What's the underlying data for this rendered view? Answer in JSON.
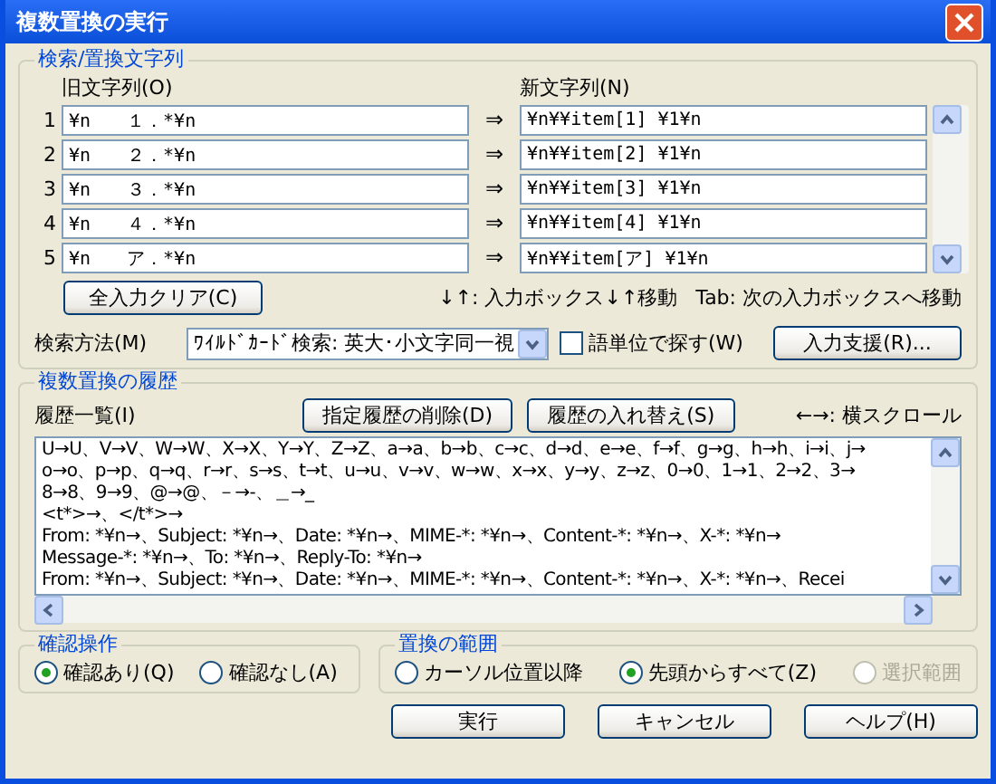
{
  "window": {
    "title": "複数置換の実行"
  },
  "search_group": {
    "title": "検索/置換文字列",
    "old_label": "旧文字列(O)",
    "new_label": "新文字列(N)",
    "rows": [
      {
        "number": "1",
        "old": "¥n　　１．*¥n",
        "arrow": "⇒",
        "new": "¥n¥¥item[1] ¥1¥n"
      },
      {
        "number": "2",
        "old": "¥n　　２．*¥n",
        "arrow": "⇒",
        "new": "¥n¥¥item[2] ¥1¥n"
      },
      {
        "number": "3",
        "old": "¥n　　３．*¥n",
        "arrow": "⇒",
        "new": "¥n¥¥item[3] ¥1¥n"
      },
      {
        "number": "4",
        "old": "¥n　　４．*¥n",
        "arrow": "⇒",
        "new": "¥n¥¥item[4] ¥1¥n"
      },
      {
        "number": "5",
        "old": "¥n　　ア．*¥n",
        "arrow": "⇒",
        "new": "¥n¥¥item[ア] ¥1¥n"
      }
    ],
    "clear_button": "全入力クリア(C)",
    "hint_arrows": "↓↑: 入力ボックス↓↑移動",
    "hint_tab": "Tab: 次の入力ボックスへ移動",
    "method_label": "検索方法(M)",
    "method_value": "ﾜｲﾙﾄﾞｶｰﾄﾞ検索: 英大･小文字同一視",
    "word_unit": {
      "label": "語単位で探す(W)",
      "checked": false
    },
    "assist_button": "入力支援(R)..."
  },
  "history_group": {
    "title": "複数置換の履歴",
    "list_label": "履歴一覧(I)",
    "delete_button": "指定履歴の削除(D)",
    "swap_button": "履歴の入れ替え(S)",
    "scroll_hint": "←→: 横スクロール",
    "lines": [
      "U→U、V→V、W→W、X→X、Y→Y、Z→Z、a→a、b→b、c→c、d→d、e→e、f→f、g→g、h→h、i→i、j→",
      "o→o、p→p、q→q、r→r、s→s、t→t、u→u、v→v、w→w、x→x、y→y、z→z、0→0、1→1、2→2、3→",
      "8→8、9→9、@→@、－→-、＿→_",
      "<t*>→、</t*>→",
      "From: *¥n→、Subject: *¥n→、Date: *¥n→、MIME-*: *¥n→、Content-*: *¥n→、X-*: *¥n→",
      "Message-*: *¥n→、To: *¥n→、Reply-To: *¥n→",
      "From: *¥n→、Subject: *¥n→、Date: *¥n→、MIME-*: *¥n→、Content-*: *¥n→、X-*: *¥n→、Recei"
    ]
  },
  "confirm_group": {
    "title": "確認操作",
    "options": [
      {
        "label": "確認あり(Q)",
        "selected": true,
        "disabled": false
      },
      {
        "label": "確認なし(A)",
        "selected": false,
        "disabled": false
      }
    ]
  },
  "range_group": {
    "title": "置換の範囲",
    "options": [
      {
        "label": "カーソル位置以降",
        "selected": false,
        "disabled": false
      },
      {
        "label": "先頭からすべて(Z)",
        "selected": true,
        "disabled": false
      },
      {
        "label": "選択範囲",
        "selected": false,
        "disabled": true
      }
    ]
  },
  "buttons": [
    "実行",
    "キャンセル",
    "ヘルプ(H)"
  ]
}
